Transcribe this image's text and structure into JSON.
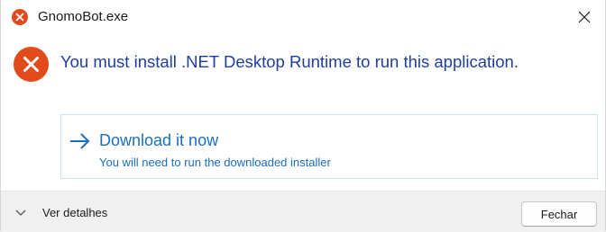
{
  "window": {
    "title": "GnomoBot.exe",
    "close_icon": "close-icon",
    "app_icon": "error-icon"
  },
  "content": {
    "message": "You must install .NET Desktop Runtime to run this application.",
    "icon": "error-icon",
    "command_link": {
      "title": "Download it now",
      "subtitle": "You will need to run the downloaded installer",
      "icon": "arrow-right-icon"
    }
  },
  "footer": {
    "details_label": "Ver detalhes",
    "details_icon": "chevron-down-icon",
    "close_button_label": "Fechar"
  },
  "colors": {
    "error_red": "#e14b1b",
    "message_blue": "#1f3f9e",
    "link_blue": "#1a6fbf",
    "footer_bg": "#f0f0f0"
  }
}
